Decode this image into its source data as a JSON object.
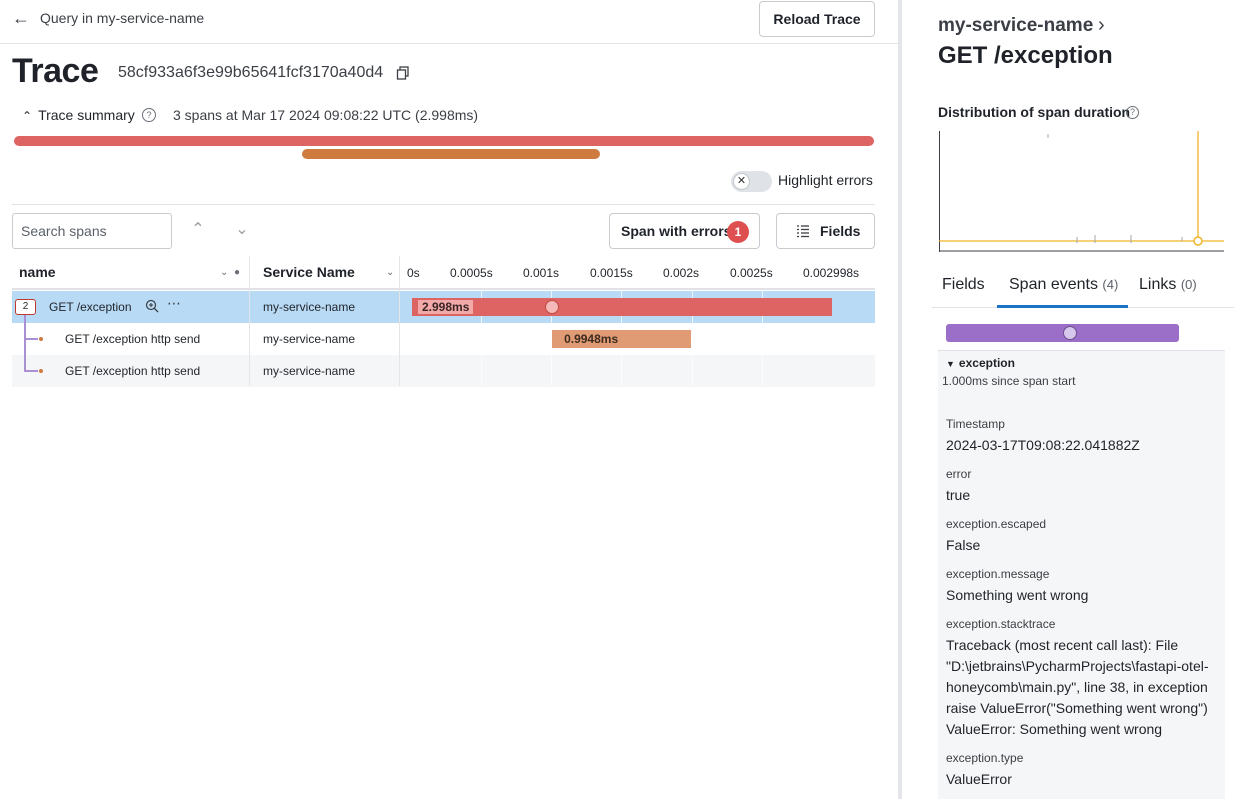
{
  "header": {
    "back_label": "Query in my-service-name",
    "reload_label": "Reload Trace"
  },
  "trace": {
    "title": "Trace",
    "id": "58cf933a6f3e99b65641fcf3170a40d4",
    "summary_label": "Trace summary",
    "summary_text": "3 spans at Mar 17 2024 09:08:22 UTC (2.998ms)"
  },
  "controls": {
    "highlight_errors_label": "Highlight errors",
    "highlight_errors_on": false,
    "search_placeholder": "Search spans",
    "span_with_errors_label": "Span with errors",
    "span_with_errors_count": "1",
    "fields_label": "Fields"
  },
  "table": {
    "col_name": "name",
    "col_service": "Service Name",
    "ticks": [
      "0s",
      "0.0005s",
      "0.001s",
      "0.0015s",
      "0.002s",
      "0.0025s",
      "0.002998s"
    ],
    "rows": [
      {
        "name": "GET /exception",
        "service": "my-service-name",
        "child_count": "2",
        "duration_label": "2.998ms",
        "start_ms": 0,
        "duration_ms": 2.998,
        "event_ms": 1.0,
        "color": "#de6464"
      },
      {
        "name": "GET /exception http send",
        "service": "my-service-name",
        "duration_label": "0.9948ms",
        "start_ms": 1.0,
        "duration_ms": 0.9948,
        "color": "#e09a74"
      },
      {
        "name": "GET /exception http send",
        "service": "my-service-name",
        "duration_label": "",
        "start_ms": 0,
        "duration_ms": 0,
        "color": "#e09a74"
      }
    ],
    "total_ms": 2.998
  },
  "detail": {
    "service_name": "my-service-name",
    "span_name": "GET /exception",
    "distribution_label": "Distribution of span duration",
    "tabs": [
      {
        "label": "Fields",
        "count": ""
      },
      {
        "label": "Span events",
        "count": "(4)"
      },
      {
        "label": "Links",
        "count": "(0)"
      }
    ],
    "active_tab": 1,
    "event": {
      "name": "exception",
      "since_start": "1.000ms since span start",
      "attributes": [
        {
          "key": "Timestamp",
          "value": "2024-03-17T09:08:22.041882Z"
        },
        {
          "key": "error",
          "value": "true"
        },
        {
          "key": "exception.escaped",
          "value": "False"
        },
        {
          "key": "exception.message",
          "value": "Something went wrong"
        },
        {
          "key": "exception.stacktrace",
          "value": "Traceback (most recent call last): File \"D:\\jetbrains\\PycharmProjects\\fastapi-otel-honeycomb\\main.py\", line 38, in exception raise ValueError(\"Something went wrong\") ValueError: Something went wrong"
        },
        {
          "key": "exception.type",
          "value": "ValueError"
        }
      ]
    }
  },
  "colors": {
    "root_span": "#de6464",
    "child_span": "#cf7a3f",
    "selected_row": "#b8daf5",
    "accent": "#1a73c7",
    "event": "#9b6fc7",
    "heatmap_line": "#f0b429"
  }
}
